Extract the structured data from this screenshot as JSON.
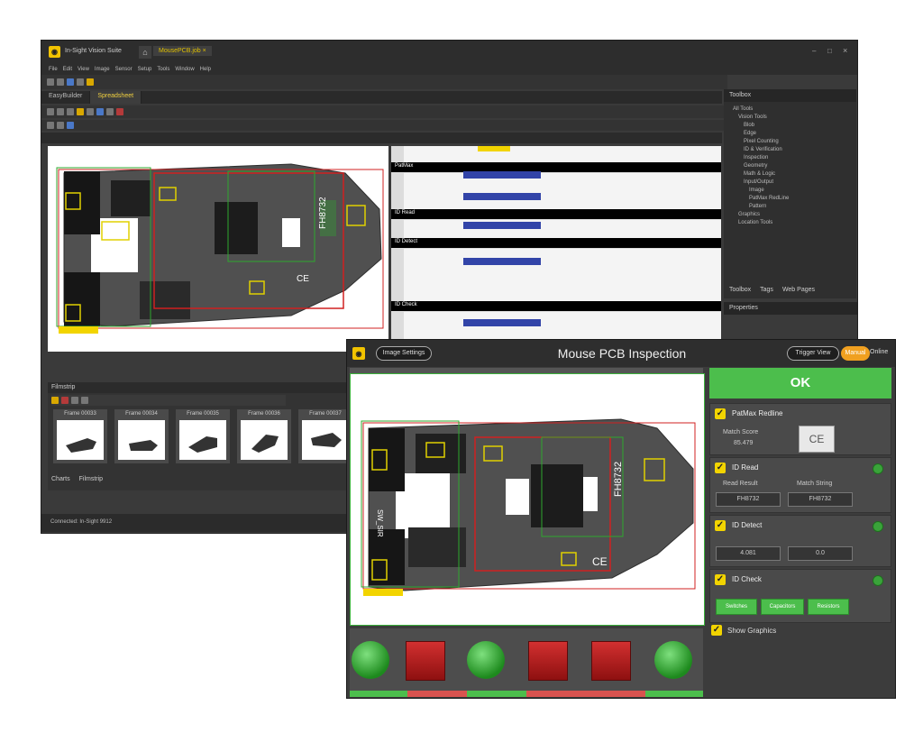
{
  "studio": {
    "app_title": "In-Sight Vision Suite",
    "doc_tab": "MousePCB.job",
    "menu": [
      "File",
      "Edit",
      "View",
      "Image",
      "Sensor",
      "Setup",
      "Tools",
      "Window",
      "Help"
    ],
    "tabs": [
      "EasyBuilder",
      "Spreadsheet"
    ],
    "sheet_sections": [
      "PatMax",
      "ID Read",
      "ID Detect",
      "ID Check"
    ],
    "toolbox_title": "Toolbox",
    "toolbox_items": [
      "All Tools",
      "Vision Tools",
      "Blob",
      "Edge",
      "Pixel Counting",
      "ID & Verification",
      "Inspection",
      "Geometry",
      "Math & Logic",
      "Input/Output",
      "Image",
      "PatMax RedLine",
      "Pattern",
      "Graphics",
      "Location Tools"
    ],
    "toolbox_tabs": [
      "Toolbox",
      "Tags",
      "Web Pages"
    ],
    "properties_title": "Properties",
    "filmstrip_title": "Filmstrip",
    "frames": [
      "Frame 00033",
      "Frame 00034",
      "Frame 00035",
      "Frame 00036",
      "Frame 00037"
    ],
    "bottom_tabs": [
      "Charts",
      "Filmstrip"
    ],
    "status": "Connected: In-Sight 9912"
  },
  "hmi": {
    "image_settings": "Image Settings",
    "title": "Mouse PCB Inspection",
    "trigger_view": "Trigger View",
    "mode_label": "Manual",
    "online_label": "Online",
    "status": "OK",
    "tools": {
      "patmax": {
        "name": "PatMax Redline",
        "score_label": "Match Score",
        "score": "85.479",
        "thumb_text": "CE"
      },
      "idread": {
        "name": "ID Read",
        "result_label": "Read Result",
        "match_label": "Match String",
        "result": "FH8732",
        "match": "FH8732"
      },
      "iddetect": {
        "name": "ID Detect",
        "v1": "4.081",
        "v2": "0.0"
      },
      "idcheck": {
        "name": "ID Check",
        "buttons": [
          "Switches",
          "Capacitors",
          "Resistors"
        ]
      }
    },
    "show_graphics": "Show Graphics",
    "results": [
      "pass",
      "fail",
      "pass",
      "fail",
      "fail",
      "pass"
    ],
    "pcb_code": "FH8732",
    "board_text": "SW_SIR",
    "ce_mark": "CE"
  },
  "colors": {
    "accent": "#f2d400",
    "pass": "#4cbe4c",
    "fail": "#c62828",
    "orange": "#f0a020"
  }
}
